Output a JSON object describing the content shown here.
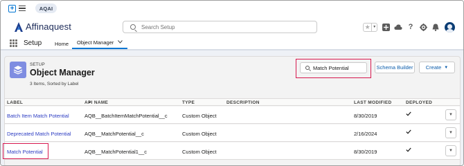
{
  "top": {
    "app_pill": "AQAI"
  },
  "header": {
    "brand": "Affinaquest",
    "search_placeholder": "Search Setup",
    "icons": [
      "favorites-star-icon",
      "favorites-dropdown-icon",
      "add-icon",
      "trailhead-icon",
      "help-icon",
      "gear-icon",
      "bell-icon",
      "avatar"
    ]
  },
  "nav": {
    "title": "Setup",
    "home": "Home",
    "active_tab": "Object Manager"
  },
  "object_manager": {
    "setup_label": "SETUP",
    "title": "Object Manager",
    "summary": "3 Items, Sorted by Label",
    "quick_find_value": "Match Potential",
    "schema_builder": "Schema Builder",
    "create": "Create"
  },
  "table": {
    "columns": [
      "LABEL",
      "API NAME",
      "TYPE",
      "DESCRIPTION",
      "LAST MODIFIED",
      "DEPLOYED"
    ],
    "rows": [
      {
        "label": "Batch Item Match Potential",
        "api_name": "AQB__BatchItemMatchPotential__c",
        "type": "Custom Object",
        "description": "",
        "last_modified": "8/30/2019",
        "deployed": true
      },
      {
        "label": "Deprecated Match Potential",
        "api_name": "AQB__MatchPotential__c",
        "type": "Custom Object",
        "description": "",
        "last_modified": "2/16/2024",
        "deployed": true
      },
      {
        "label": "Match Potential",
        "api_name": "AQB__MatchPotential1__c",
        "type": "Custom Object",
        "description": "",
        "last_modified": "8/30/2019",
        "deployed": true
      }
    ]
  },
  "colors": {
    "brand_blue": "#0176d3",
    "link": "#2b3bc2",
    "highlight": "#d7174e",
    "object_icon": "#7f8de1"
  }
}
